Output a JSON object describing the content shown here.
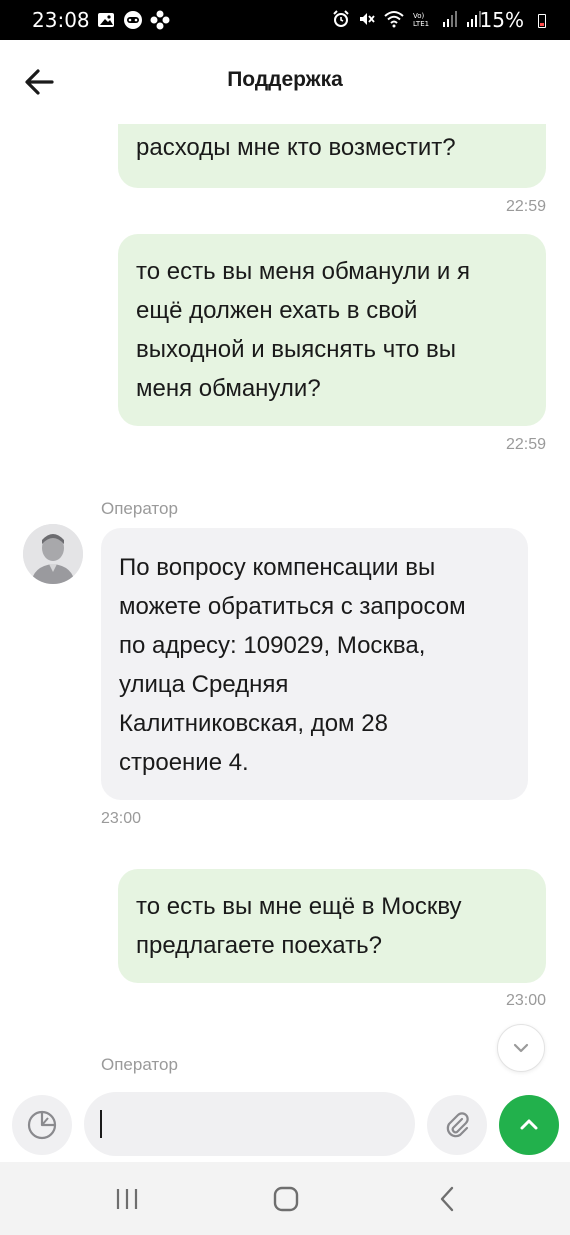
{
  "status_bar": {
    "time": "23:08",
    "battery": "15%",
    "icons_left": [
      "gallery-icon",
      "gamepad-icon",
      "app-icon"
    ],
    "icons_right": [
      "alarm-icon",
      "mute-icon",
      "wifi-icon",
      "volte-icon",
      "signal-icon",
      "signal-icon-2"
    ]
  },
  "header": {
    "title": "Поддержка"
  },
  "messages": [
    {
      "direction": "outgoing",
      "lines": [
        "расходы мне кто возместит?"
      ],
      "time": "22:59",
      "partially_visible": true
    },
    {
      "direction": "outgoing",
      "lines": [
        "то есть вы меня обманули и я",
        "ещё должен ехать в свой",
        "выходной и выяснять что вы",
        "меня обманули?"
      ],
      "time": "22:59"
    },
    {
      "direction": "incoming",
      "sender": "Оператор",
      "lines": [
        "По вопросу компенсации вы",
        "можете обратиться с запросом",
        "по адресу: 109029, Москва,",
        "улица Средняя",
        "Калитниковская, дом 28",
        "строение 4."
      ],
      "time": "23:00"
    },
    {
      "direction": "outgoing",
      "lines": [
        "то есть вы мне ещё в Москву",
        "предлагаете поехать?"
      ],
      "time": "23:00"
    },
    {
      "direction": "incoming",
      "sender": "Оператор",
      "partially_visible": true
    }
  ],
  "composer": {
    "input_value": "",
    "icons": [
      "sticker-icon",
      "paperclip-icon",
      "chevron-up-icon"
    ]
  },
  "colors": {
    "outgoing_bubble": "#e6f4e1",
    "incoming_bubble": "#f2f2f4",
    "send_button": "#22b14c"
  }
}
